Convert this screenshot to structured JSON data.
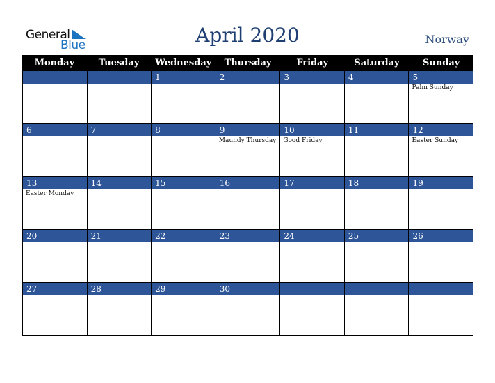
{
  "logo": {
    "general": "General",
    "blue": "Blue"
  },
  "title": "April 2020",
  "country": "Norway",
  "weekdays": [
    "Monday",
    "Tuesday",
    "Wednesday",
    "Thursday",
    "Friday",
    "Saturday",
    "Sunday"
  ],
  "weeks": [
    [
      {
        "d": "",
        "e": ""
      },
      {
        "d": "",
        "e": ""
      },
      {
        "d": "1",
        "e": ""
      },
      {
        "d": "2",
        "e": ""
      },
      {
        "d": "3",
        "e": ""
      },
      {
        "d": "4",
        "e": ""
      },
      {
        "d": "5",
        "e": "Palm Sunday"
      }
    ],
    [
      {
        "d": "6",
        "e": ""
      },
      {
        "d": "7",
        "e": ""
      },
      {
        "d": "8",
        "e": ""
      },
      {
        "d": "9",
        "e": "Maundy Thursday"
      },
      {
        "d": "10",
        "e": "Good Friday"
      },
      {
        "d": "11",
        "e": ""
      },
      {
        "d": "12",
        "e": "Easter Sunday"
      }
    ],
    [
      {
        "d": "13",
        "e": "Easter Monday"
      },
      {
        "d": "14",
        "e": ""
      },
      {
        "d": "15",
        "e": ""
      },
      {
        "d": "16",
        "e": ""
      },
      {
        "d": "17",
        "e": ""
      },
      {
        "d": "18",
        "e": ""
      },
      {
        "d": "19",
        "e": ""
      }
    ],
    [
      {
        "d": "20",
        "e": ""
      },
      {
        "d": "21",
        "e": ""
      },
      {
        "d": "22",
        "e": ""
      },
      {
        "d": "23",
        "e": ""
      },
      {
        "d": "24",
        "e": ""
      },
      {
        "d": "25",
        "e": ""
      },
      {
        "d": "26",
        "e": ""
      }
    ],
    [
      {
        "d": "27",
        "e": ""
      },
      {
        "d": "28",
        "e": ""
      },
      {
        "d": "29",
        "e": ""
      },
      {
        "d": "30",
        "e": ""
      },
      {
        "d": "",
        "e": ""
      },
      {
        "d": "",
        "e": ""
      },
      {
        "d": "",
        "e": ""
      }
    ]
  ]
}
